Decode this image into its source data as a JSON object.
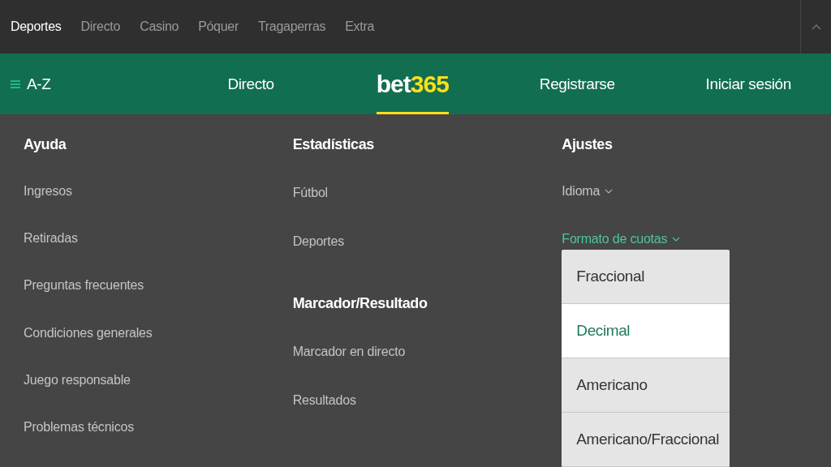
{
  "top_nav": [
    {
      "label": "Deportes",
      "selected": true
    },
    {
      "label": "Directo",
      "selected": false
    },
    {
      "label": "Casino",
      "selected": false
    },
    {
      "label": "Póquer",
      "selected": false
    },
    {
      "label": "Tragaperras",
      "selected": false
    },
    {
      "label": "Extra",
      "selected": false
    }
  ],
  "header": {
    "menu": "A-Z",
    "live": "Directo",
    "logo": {
      "word": "bet",
      "number": "365"
    },
    "register": "Registrarse",
    "login": "Iniciar sesión"
  },
  "columns": [
    {
      "heading": "Ayuda",
      "items": [
        {
          "label": "Ingresos"
        },
        {
          "label": "Retiradas"
        },
        {
          "label": "Preguntas frecuentes"
        },
        {
          "label": "Condiciones generales"
        },
        {
          "label": "Juego responsable"
        },
        {
          "label": "Problemas técnicos"
        }
      ]
    },
    {
      "heading": "Estadísticas",
      "items": [
        {
          "label": "Fútbol"
        },
        {
          "label": "Deportes"
        }
      ],
      "subheading": "Marcador/Resultado",
      "subitems": [
        {
          "label": "Marcador en directo"
        },
        {
          "label": "Resultados"
        }
      ]
    },
    {
      "heading": "Ajustes",
      "settings": [
        {
          "label": "Idioma",
          "expanded": false
        },
        {
          "label": "Formato de cuotas",
          "expanded": true,
          "options": [
            {
              "label": "Fraccional",
              "selected": false
            },
            {
              "label": "Decimal",
              "selected": true
            },
            {
              "label": "Americano",
              "selected": false
            },
            {
              "label": "Americano/Fraccional",
              "selected": false
            }
          ]
        }
      ]
    }
  ]
}
